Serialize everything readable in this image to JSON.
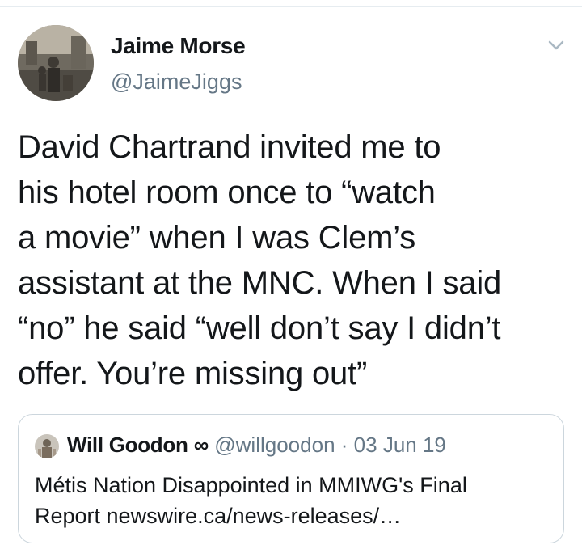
{
  "tweet": {
    "author": {
      "name": "Jaime Morse",
      "handle": "@JaimeJiggs"
    },
    "text_lines": [
      "David Chartrand invited me to",
      "his hotel room once to “watch",
      "a movie” when I was Clem’s",
      "assistant at the MNC. When I said",
      "“no” he said “well don’t say I didn’t",
      "offer. You’re missing out”"
    ],
    "menu_icon": "chevron-down-icon"
  },
  "quoted_tweet": {
    "name": "Will Goodon",
    "name_symbol": "∞",
    "handle": "@willgoodon",
    "separator": "·",
    "date": "03 Jun 19",
    "text_lines": [
      "Métis Nation Disappointed in MMIWG's Final",
      "Report newswire.ca/news-releases/…"
    ]
  },
  "colors": {
    "text": "#14171a",
    "secondary": "#657786",
    "border": "#ccd6dd",
    "caret": "#aab8c2"
  }
}
